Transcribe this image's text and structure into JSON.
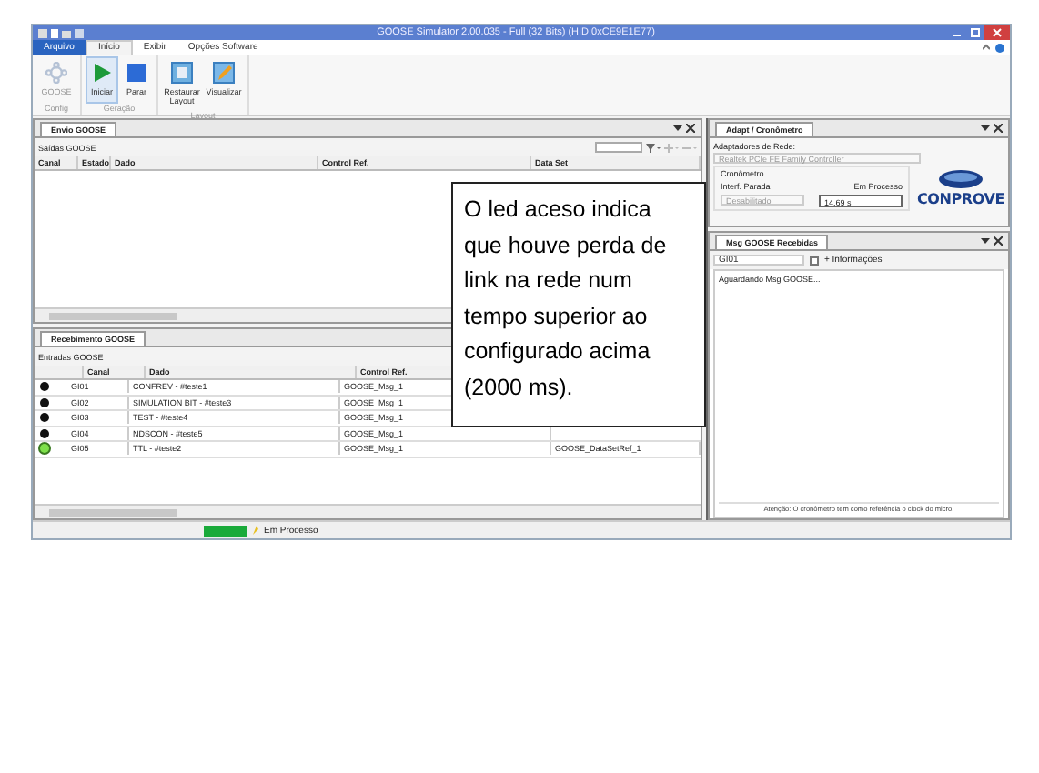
{
  "window": {
    "title": "GOOSE Simulator 2.00.035 - Full (32 Bits) (HID:0xCE9E1E77)"
  },
  "menu_tabs": [
    {
      "label": "Arquivo",
      "kind": "file",
      "selected": false
    },
    {
      "label": "Início",
      "kind": "tab",
      "selected": true
    },
    {
      "label": "Exibir",
      "kind": "tab",
      "selected": false
    },
    {
      "label": "Opções Software",
      "kind": "tab",
      "selected": false
    }
  ],
  "ribbon_groups": [
    {
      "label": "Config",
      "buttons": [
        {
          "label": "GOOSE",
          "kind": "gear",
          "disabled": true,
          "selected": false
        }
      ]
    },
    {
      "label": "Geração",
      "buttons": [
        {
          "label": "Iniciar",
          "kind": "play",
          "disabled": false,
          "selected": true
        },
        {
          "label": "Parar",
          "kind": "stop",
          "disabled": false,
          "selected": false
        }
      ]
    },
    {
      "label": "Layout",
      "buttons": [
        {
          "label": "Restaurar Layout",
          "kind": "layout",
          "disabled": false,
          "selected": false
        },
        {
          "label": "Visualizar",
          "kind": "edit",
          "disabled": false,
          "selected": false
        }
      ]
    }
  ],
  "send_panel": {
    "tab": "Envio GOOSE",
    "title": "Saídas GOOSE",
    "columns": [
      "Canal",
      "Estado",
      "Dado",
      "Control Ref.",
      "Data Set"
    ]
  },
  "receive_panel": {
    "tab": "Recebimento GOOSE",
    "title": "Entradas GOOSE",
    "columns": [
      "Canal",
      "Dado",
      "Control Ref."
    ],
    "rows": [
      {
        "led_on": false,
        "canal": "GI01",
        "dado": "CONFREV - #teste1",
        "control_ref": "GOOSE_Msg_1"
      },
      {
        "led_on": false,
        "canal": "GI02",
        "dado": "SIMULATION BIT - #teste3",
        "control_ref": "GOOSE_Msg_1"
      },
      {
        "led_on": false,
        "canal": "GI03",
        "dado": "TEST - #teste4",
        "control_ref": "GOOSE_Msg_1"
      },
      {
        "led_on": false,
        "canal": "GI04",
        "dado": "NDSCON - #teste5",
        "control_ref": "GOOSE_Msg_1"
      },
      {
        "led_on": true,
        "canal": "GI05",
        "dado": "TTL - #teste2",
        "control_ref": "GOOSE_Msg_1",
        "data_set": "GOOSE_DataSetRef_1"
      }
    ]
  },
  "adapter_panel": {
    "tab": "Adapt / Cronômetro",
    "adapter_label": "Adaptadores de Rede:",
    "adapter": "Realtek PCIe FE Family Controller",
    "chrono_label": "Cronômetro",
    "stop_label": "Interf. Parada",
    "stop_value": "Desabilitado",
    "status_label": "Em Processo",
    "time": "14.69 s",
    "logo": "CONPROVE"
  },
  "messages_panel": {
    "tab": "Msg GOOSE Recebidas",
    "channel": "GI01",
    "more_info": {
      "label": "+ Informações",
      "checked": false
    },
    "log": "Aguardando Msg GOOSE...",
    "note": "Atenção: O cronômetro tem como referência o clock do micro."
  },
  "status_bar": {
    "level": 1,
    "text": "Em Processo"
  },
  "callout": {
    "text": "O led aceso indica que houve perda de link na rede num tempo superior ao configurado acima (2000 ms)."
  }
}
